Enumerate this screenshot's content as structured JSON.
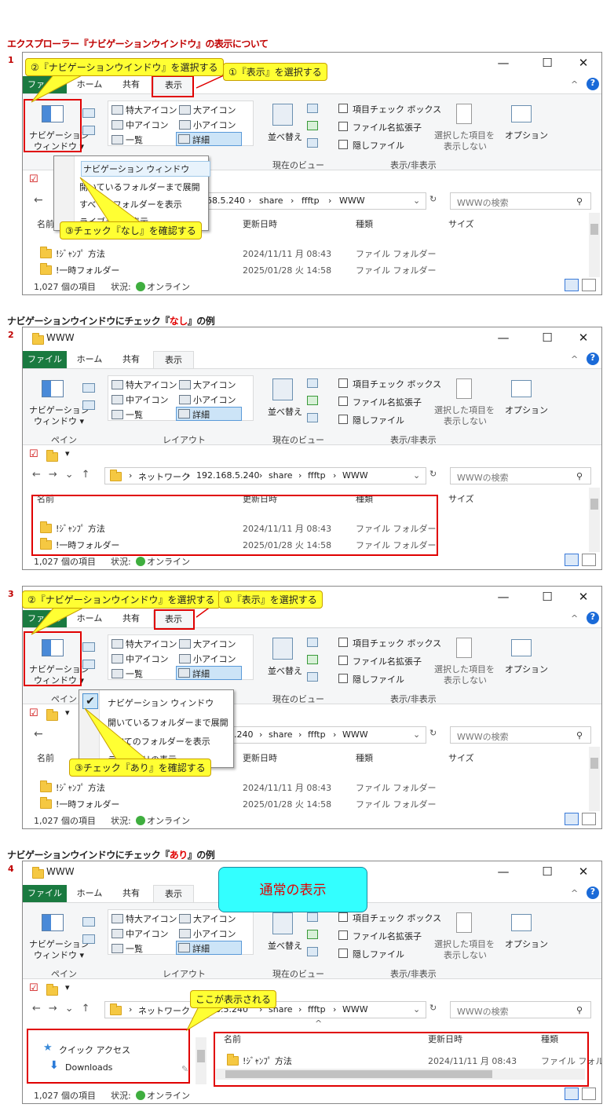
{
  "heading": "エクスプローラー『ナビゲーションウインドウ』の表示について",
  "panels": [
    {
      "num": "1",
      "window_title": "",
      "callouts": [
        "②『ナビゲーションウインドウ』を選択する",
        "①『表示』を選択する",
        "③チェック『なし』を確認する"
      ],
      "menu": [
        "ナビゲーション ウィンドウ",
        "開いているフォルダーまで展開",
        "すべてのフォルダーを表示",
        "ライブラリの表示"
      ]
    },
    {
      "num": "2",
      "subtitle_pre": "ナビゲーションウインドウにチェック『",
      "subtitle_hl": "なし",
      "subtitle_post": "』の例",
      "window_title": "WWW"
    },
    {
      "num": "3",
      "callouts": [
        "②『ナビゲーションウインドウ』を選択する",
        "①『表示』を選択する",
        "③チェック『あり』を確認する"
      ],
      "menu": [
        "ナビゲーション ウィンドウ",
        "開いているフォルダーまで展開",
        "すべてのフォルダーを表示",
        "ライブラリの表示"
      ]
    },
    {
      "num": "4",
      "subtitle_pre": "ナビゲーションウインドウにチェック『",
      "subtitle_hl": "あり",
      "subtitle_post": "』の例",
      "window_title": "WWW",
      "banner": "通常の表示",
      "callout": "ここが表示される",
      "nav_items": [
        "クイック アクセス",
        "Downloads"
      ]
    }
  ],
  "controls": {
    "min": "—",
    "max": "☐",
    "close": "✕"
  },
  "tabs": {
    "file": "ファイル",
    "home": "ホーム",
    "share": "共有",
    "view": "表示"
  },
  "ribbon": {
    "nav_pane": "ナビゲーション",
    "nav_pane2": "ウィンドウ ▾",
    "layout": [
      "特大アイコン",
      "大アイコン",
      "中アイコン",
      "小アイコン",
      "一覧",
      "詳細"
    ],
    "sort": "並べ替え",
    "sort2": "え",
    "checks": [
      "項目チェック ボックス",
      "ファイル名拡張子",
      "隠しファイル"
    ],
    "hide1": "選択した項目を",
    "hide2": "表示しない",
    "options": "オプション",
    "grp_pane": "ペイン",
    "grp_layout": "レイアウト",
    "grp_view": "現在のビュー",
    "grp_show": "表示/非表示"
  },
  "address": {
    "network": "ネットワーク",
    "ip": "192.168.5.240",
    "share": "share",
    "ffftp": "ffftp",
    "www": "WWW",
    "ip_partial": "168.5.240",
    "ip_partial2": ".240",
    "search": "WWWの検索"
  },
  "columns": {
    "name": "名前",
    "date": "更新日時",
    "type": "種類",
    "size": "サイズ"
  },
  "rows": [
    {
      "name": "!ｼﾞｬﾝﾌﾟ 方法",
      "date": "2024/11/11 月 08:43",
      "type": "ファイル フォルダー"
    },
    {
      "name": "!一時フォルダー",
      "date": "2025/01/28 火 14:58",
      "type": "ファイル フォルダー"
    }
  ],
  "type_partial": "ファイル フォル",
  "status": {
    "count": "1,027 個の項目",
    "state": "状況:",
    "online": "オンライン"
  }
}
